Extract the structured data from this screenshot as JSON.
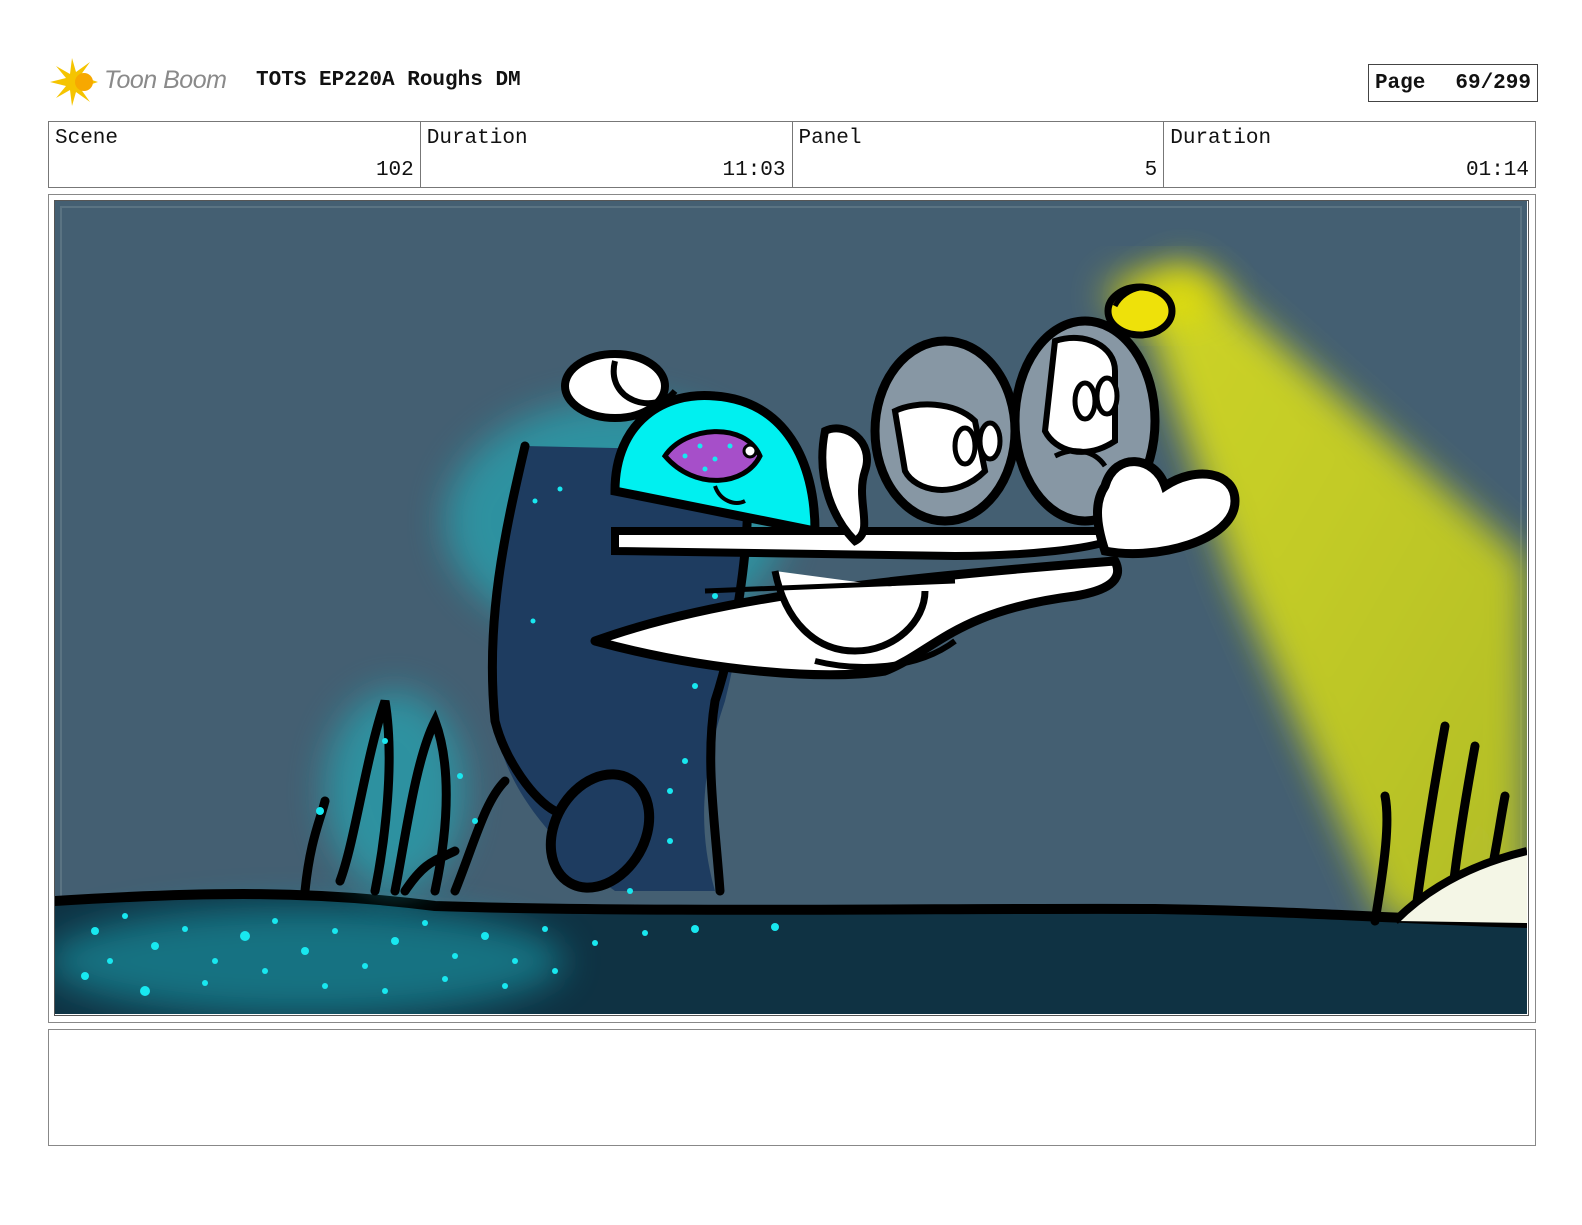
{
  "header": {
    "logo_text": "Toon Boom",
    "title": "TOTS EP220A Roughs DM",
    "page_label": "Page",
    "page_value": "69/299"
  },
  "info": [
    {
      "label": "Scene",
      "value": "102"
    },
    {
      "label": "Duration",
      "value": "11:03"
    },
    {
      "label": "Panel",
      "value": "5"
    },
    {
      "label": "Duration",
      "value": "01:14"
    }
  ],
  "panel": {
    "caption": "",
    "colors": {
      "water": "#445f72",
      "seafloor": "#0f3243",
      "glow_cyan": "#00f0f0",
      "flashlight_yellow": "#c8cf1e",
      "fish_purple": "#a64fc9"
    }
  }
}
